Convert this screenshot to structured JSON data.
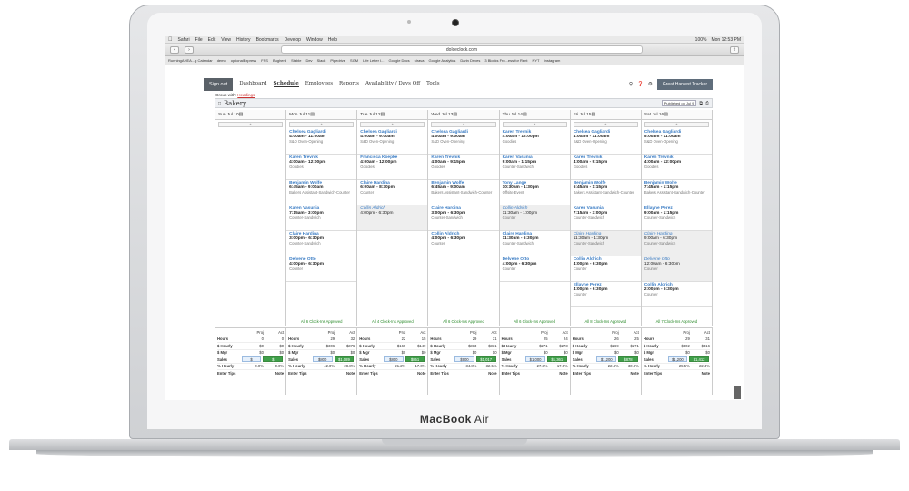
{
  "menubar": {
    "items": [
      "Safari",
      "File",
      "Edit",
      "View",
      "History",
      "Bookmarks",
      "Develop",
      "Window",
      "Help"
    ],
    "battery": "100%",
    "clock": "Mon 12:53 PM"
  },
  "browser": {
    "url": "dolceclock.com"
  },
  "bookmarks": [
    "RunningAHEA...g Calendar",
    "demo",
    "optionalExpress",
    "FSS",
    "Bugherd",
    "Stable",
    "Dev",
    "Slack",
    "Pipedrive",
    "SGM",
    "Life Letter I...",
    "Google Docs",
    "strava",
    "Google Analytics",
    "Darin Drives",
    "3 Blocks Fro...ess for Rent",
    "NYT",
    "Instagram"
  ],
  "nav": {
    "signout": "Sign out",
    "items": [
      "Dashboard",
      "Schedule",
      "Employees",
      "Reports",
      "Availability / Days Off",
      "Tools"
    ],
    "tracker": "Great Harvest Tracker"
  },
  "group": {
    "label": "Group with:",
    "value": "Headings"
  },
  "board": {
    "title": "Bakery",
    "published": "Published on Jul 9"
  },
  "days": [
    {
      "date": "Sun Jul 10",
      "shifts": [],
      "approved": ""
    },
    {
      "date": "Mon Jul 11",
      "shifts": [
        {
          "name": "Chelsea Gagliardi",
          "time": "4:00am - 11:00am",
          "role": "S&D Oven-Opening"
        },
        {
          "name": "Karen Trevnik",
          "time": "4:00am - 12:00pm",
          "role": "Goodies"
        },
        {
          "name": "Benjamin Wolfe",
          "time": "6:45am - 9:00am",
          "role": "Bakers Assistant-Sandwich-Counter"
        },
        {
          "name": "Karen Vasunia",
          "time": "7:15am - 3:00pm",
          "role": "Counter-Sandwich"
        },
        {
          "name": "Claire Hardina",
          "time": "3:00pm - 6:30pm",
          "role": "Counter-Sandwich"
        },
        {
          "name": "Delvene Otto",
          "time": "4:00pm - 6:30pm",
          "role": "Counter"
        }
      ],
      "approved": "All 6 Clock-Ins Approved"
    },
    {
      "date": "Tue Jul 12",
      "shifts": [
        {
          "name": "Chelsea Gagliardi",
          "time": "4:00am - 9:00am",
          "role": "S&D Oven-Opening"
        },
        {
          "name": "Francisca Koepke",
          "time": "4:00am - 12:00pm",
          "role": "Goodies"
        },
        {
          "name": "Claire Hardina",
          "time": "6:00am - 8:30pm",
          "role": "Counter"
        },
        {
          "name": "Collin Aldrich",
          "time": "4:00pm - 6:30pm",
          "role": "",
          "open": true
        }
      ],
      "approved": "All 4 Clock-Ins Approved"
    },
    {
      "date": "Wed Jul 13",
      "shifts": [
        {
          "name": "Chelsea Gagliardi",
          "time": "4:00am - 9:00am",
          "role": "S&D Oven-Opening"
        },
        {
          "name": "Karen Trevnik",
          "time": "4:00am - 9:15pm",
          "role": "Goodies"
        },
        {
          "name": "Benjamin Wolfe",
          "time": "6:45am - 9:00am",
          "role": "Bakers Assistant-Sandwich-Counter"
        },
        {
          "name": "Claire Hardina",
          "time": "3:00pm - 6:30pm",
          "role": "Counter-Sandwich"
        },
        {
          "name": "Collin Aldrich",
          "time": "4:00pm - 6:30pm",
          "role": "Counter"
        }
      ],
      "approved": "All 6 Clock-Ins Approved"
    },
    {
      "date": "Thu Jul 14",
      "shifts": [
        {
          "name": "Karen Trevnik",
          "time": "4:00am - 12:00pm",
          "role": "Goodies"
        },
        {
          "name": "Karen Vasunia",
          "time": "9:00am - 1:15pm",
          "role": "Counter-Sandwich"
        },
        {
          "name": "Tony Lange",
          "time": "10:30am - 1:30pm",
          "role": "Offsite Event"
        },
        {
          "name": "Collin Aldrich",
          "time": "11:30am - 1:00pm",
          "role": "Counter",
          "open": true
        },
        {
          "name": "Claire Hardina",
          "time": "11:30am - 6:30pm",
          "role": "Counter-Sandwich"
        },
        {
          "name": "Delvene Otto",
          "time": "4:00pm - 6:30pm",
          "role": "Counter"
        }
      ],
      "approved": "All 6 Clock-Ins Approved"
    },
    {
      "date": "Fri Jul 15",
      "shifts": [
        {
          "name": "Chelsea Gagliardi",
          "time": "4:00am - 11:00am",
          "role": "S&D Oven-Opening"
        },
        {
          "name": "Karen Trevnik",
          "time": "4:00am - 9:15pm",
          "role": "Goodies"
        },
        {
          "name": "Benjamin Wolfe",
          "time": "6:45am - 1:15pm",
          "role": "Bakers Assistant-Sandwich-Counter"
        },
        {
          "name": "Karen Vasunia",
          "time": "7:15am - 3:00pm",
          "role": "Counter-Sandwich"
        },
        {
          "name": "Claire Hardina",
          "time": "11:30am - 1:30pm",
          "role": "Counter-Sandwich",
          "open": true
        },
        {
          "name": "Collin Aldrich",
          "time": "4:00pm - 6:30pm",
          "role": "Counter"
        },
        {
          "name": "Ellayne Perez",
          "time": "4:00pm - 6:30pm",
          "role": "Counter"
        }
      ],
      "approved": "All 8 Clock-Ins Approved"
    },
    {
      "date": "Sat Jul 16",
      "shifts": [
        {
          "name": "Chelsea Gagliardi",
          "time": "5:00am - 11:00am",
          "role": "S&D Oven-Opening"
        },
        {
          "name": "Karen Trevnik",
          "time": "4:00am - 12:00pm",
          "role": "Goodies"
        },
        {
          "name": "Benjamin Wolfe",
          "time": "7:45am - 1:15pm",
          "role": "Bakers Assistant-Sandwich-Counter"
        },
        {
          "name": "Ellayne Perez",
          "time": "9:00am - 1:15pm",
          "role": "Counter-Sandwich"
        },
        {
          "name": "Claire Hardina",
          "time": "9:00am - 6:30pm",
          "role": "Counter-Sandwich",
          "open": true
        },
        {
          "name": "Delvene Otto",
          "time": "12:00am - 6:30pm",
          "role": "Counter",
          "open": true
        },
        {
          "name": "Collin Aldrich",
          "time": "2:00pm - 6:30pm",
          "role": "Counter"
        }
      ],
      "approved": "All 7 Clock-Ins Approved"
    }
  ],
  "summary": {
    "labels": {
      "proj": "Proj",
      "act": "Act",
      "hours": "Hours",
      "hourly": "$ Hourly",
      "mgr": "$ Mgr",
      "sales": "Sales",
      "pct": "% Hourly",
      "tips": "Enter Tips",
      "note": "Note"
    },
    "cols": [
      {
        "hours": [
          "0",
          "0"
        ],
        "hourly": [
          "$0",
          "$0"
        ],
        "mgr": [
          "$0",
          "$0"
        ],
        "sales": [
          "$",
          "$"
        ],
        "pct": [
          "0.0%",
          "0.0%"
        ]
      },
      {
        "hours": [
          "29",
          "32"
        ],
        "hourly": [
          "$306",
          "$376"
        ],
        "mgr": [
          "$0",
          "$0"
        ],
        "sales": [
          "$800",
          "$1,089"
        ],
        "pct": [
          "42.0%",
          "28.8%"
        ]
      },
      {
        "hours": [
          "22",
          "15"
        ],
        "hourly": [
          "$169",
          "$149"
        ],
        "mgr": [
          "$0",
          "$0"
        ],
        "sales": [
          "$800",
          "$851"
        ],
        "pct": [
          "21.2%",
          "17.0%"
        ]
      },
      {
        "hours": [
          "29",
          "31"
        ],
        "hourly": [
          "$313",
          "$331"
        ],
        "mgr": [
          "$0",
          "$0"
        ],
        "sales": [
          "$900",
          "$1,017"
        ],
        "pct": [
          "34.8%",
          "32.5%"
        ]
      },
      {
        "hours": [
          "25",
          "24"
        ],
        "hourly": [
          "$271",
          "$273"
        ],
        "mgr": [
          "$0",
          "$0"
        ],
        "sales": [
          "$1,000",
          "$1,361"
        ],
        "pct": [
          "27.3%",
          "17.0%"
        ]
      },
      {
        "hours": [
          "26",
          "25"
        ],
        "hourly": [
          "$269",
          "$271"
        ],
        "mgr": [
          "$0",
          "$0"
        ],
        "sales": [
          "$1,200",
          "$878"
        ],
        "pct": [
          "22.4%",
          "30.8%"
        ]
      },
      {
        "hours": [
          "29",
          "31"
        ],
        "hourly": [
          "$302",
          "$316"
        ],
        "mgr": [
          "$0",
          "$0"
        ],
        "sales": [
          "$1,200",
          "$1,412"
        ],
        "pct": [
          "25.5%",
          "22.4%"
        ]
      }
    ]
  },
  "device": {
    "brand": "MacBook",
    "model": "Air"
  }
}
